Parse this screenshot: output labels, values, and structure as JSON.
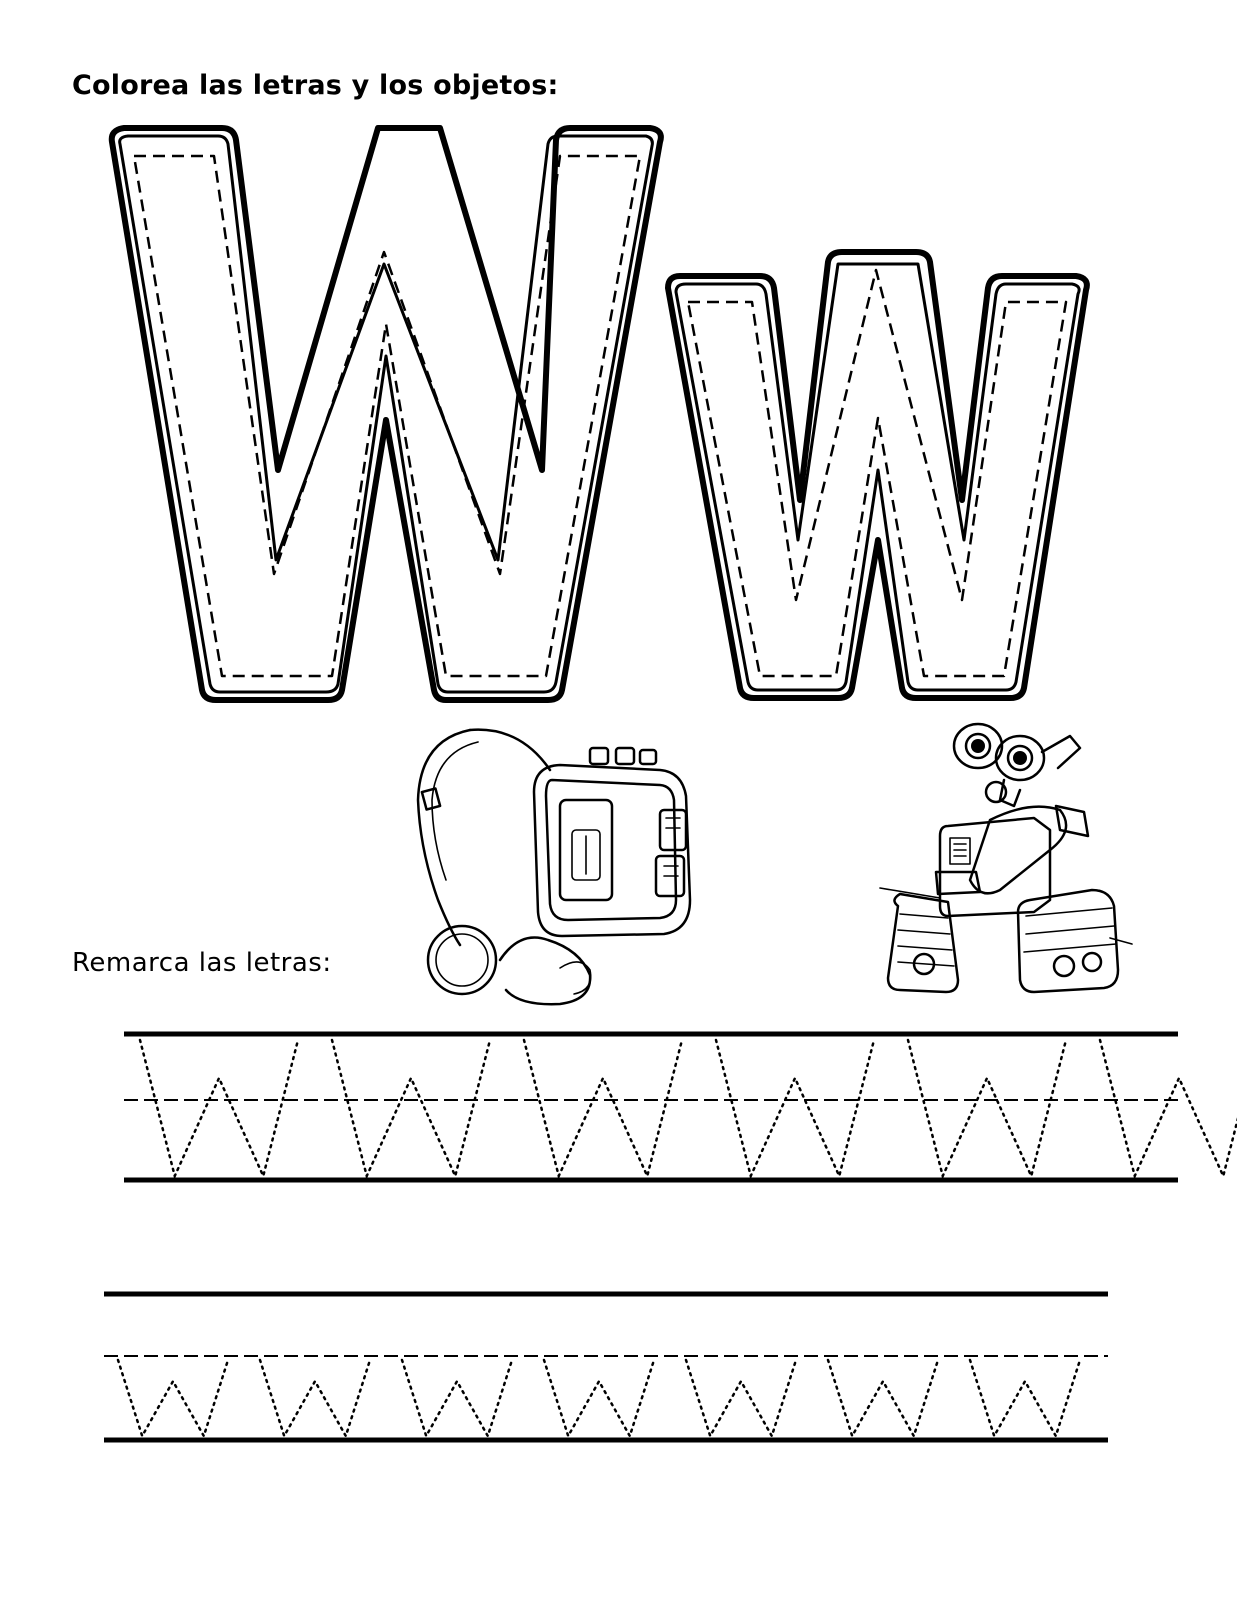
{
  "worksheet": {
    "color_instruction": "Colorea las letras y los objetos:",
    "trace_instruction": "Remarca las letras:"
  },
  "letters": {
    "uppercase": "W",
    "lowercase": "w"
  },
  "pictures": {
    "left": "walkman-illustration",
    "right": "wall-e-illustration"
  },
  "tracing": {
    "uppercase_row_count": 6,
    "lowercase_row_count": 7
  }
}
